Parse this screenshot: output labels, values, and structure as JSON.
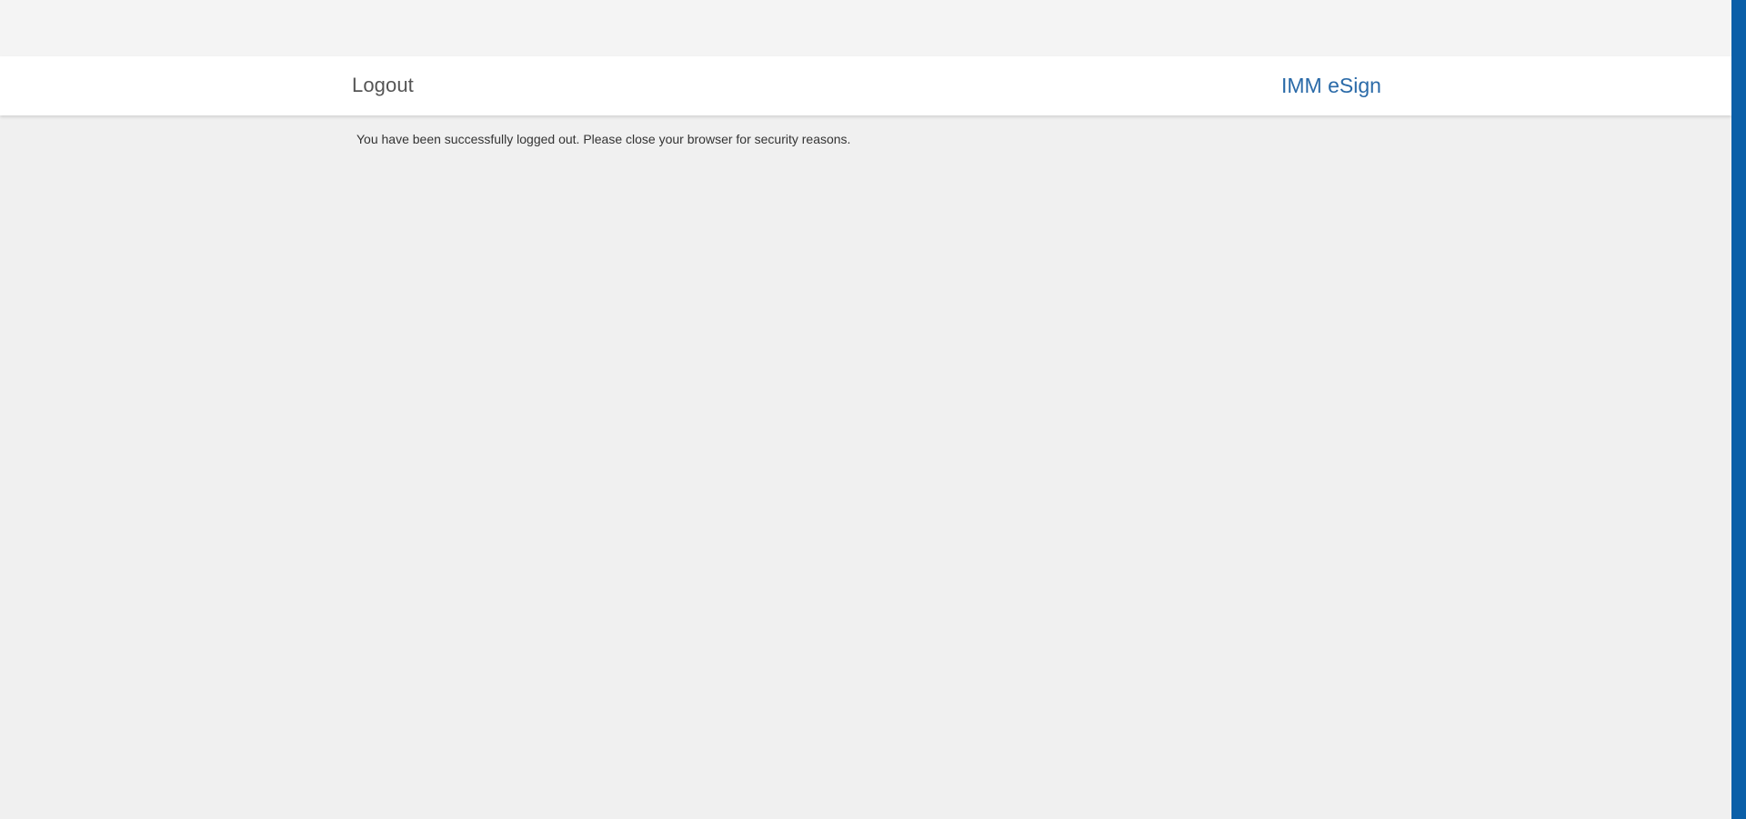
{
  "header": {
    "title": "Logout",
    "brand": "IMM eSign"
  },
  "main": {
    "message": "You have been successfully logged out. Please close your browser for security reasons."
  },
  "colors": {
    "brand": "#2a6aa8",
    "accent_bar": "#0b5fa8",
    "page_background": "#f0f0f0",
    "header_background": "#ffffff"
  }
}
